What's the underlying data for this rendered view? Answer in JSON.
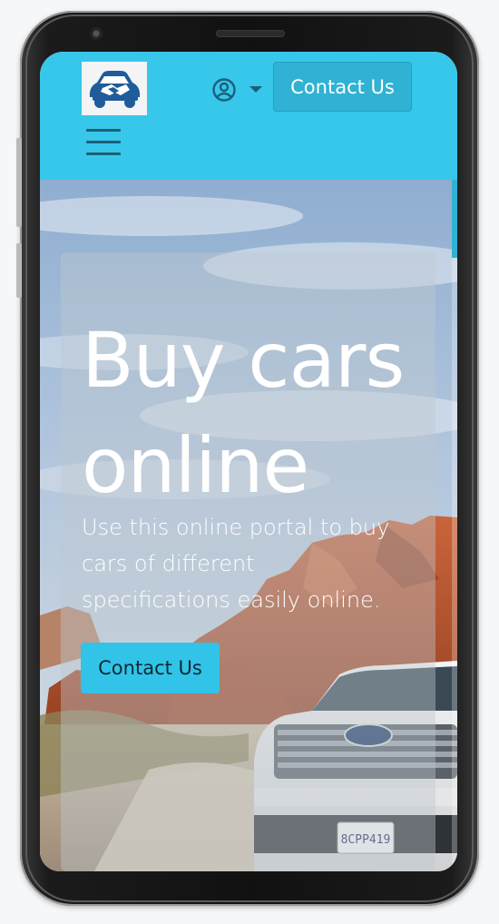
{
  "header": {
    "contact_label": "Contact Us"
  },
  "hero": {
    "title": "Buy cars online",
    "subtitle": "Use this online portal to buy cars of different specifications easily online.",
    "button_label": "Contact Us"
  },
  "colors": {
    "header_bg": "#36c7eb",
    "header_button": "#2fb2d4",
    "hero_button": "#32c3e8",
    "icon_dark": "#1d5f79"
  },
  "icons": {
    "logo": "car-handshake-logo",
    "account": "user-circle-icon",
    "dropdown": "caret-down-icon",
    "menu": "hamburger-menu-icon"
  }
}
